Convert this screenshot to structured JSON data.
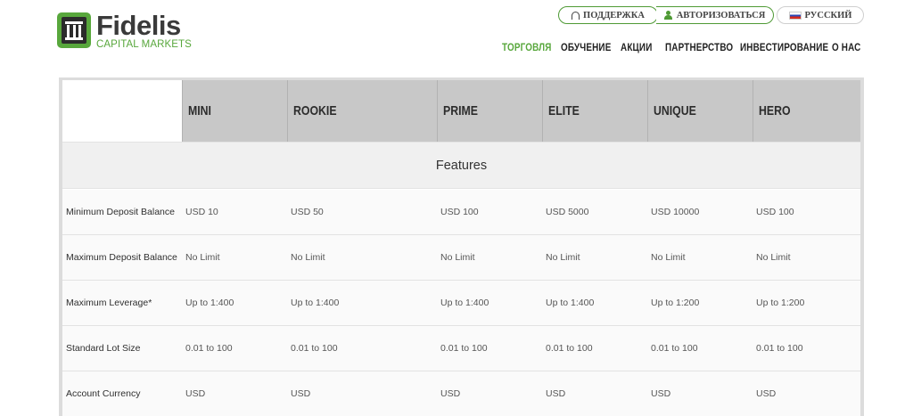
{
  "brand": {
    "name": "Fidelis",
    "subtitle": "CAPITAL MARKETS",
    "accent_color": "#58a73c"
  },
  "top_links": {
    "support": "ПОДДЕРЖКА",
    "login": "АВТОРИЗОВАТЬСЯ",
    "language": "РУССКИЙ"
  },
  "nav": {
    "items": [
      "ТОРГОВЛЯ",
      "ОБУЧЕНИЕ",
      "АКЦИИ",
      "ПАРТНЕРСТВО",
      "ИНВЕСТИРОВАНИЕ",
      "О НАС"
    ],
    "active_index": 0
  },
  "table": {
    "columns": [
      "MINI",
      "ROOKIE",
      "PRIME",
      "ELITE",
      "UNIQUE",
      "HERO"
    ],
    "section_title": "Features",
    "rows": [
      {
        "label": "Minimum Deposit Balance",
        "values": [
          "USD 10",
          "USD 50",
          "USD 100",
          "USD 5000",
          "USD 10000",
          "USD 100"
        ]
      },
      {
        "label": "Maximum Deposit Balance",
        "values": [
          "No Limit",
          "No Limit",
          "No Limit",
          "No Limit",
          "No Limit",
          "No Limit"
        ]
      },
      {
        "label": "Maximum Leverage*",
        "values": [
          "Up to 1:400",
          "Up to 1:400",
          "Up to 1:400",
          "Up to 1:400",
          "Up to 1:200",
          "Up to 1:200"
        ]
      },
      {
        "label": "Standard Lot Size",
        "values": [
          "0.01 to 100",
          "0.01 to 100",
          "0.01 to 100",
          "0.01 to 100",
          "0.01 to 100",
          "0.01 to 100"
        ]
      },
      {
        "label": "Account Currency",
        "values": [
          "USD",
          "USD",
          "USD",
          "USD",
          "USD",
          "USD"
        ]
      }
    ]
  }
}
